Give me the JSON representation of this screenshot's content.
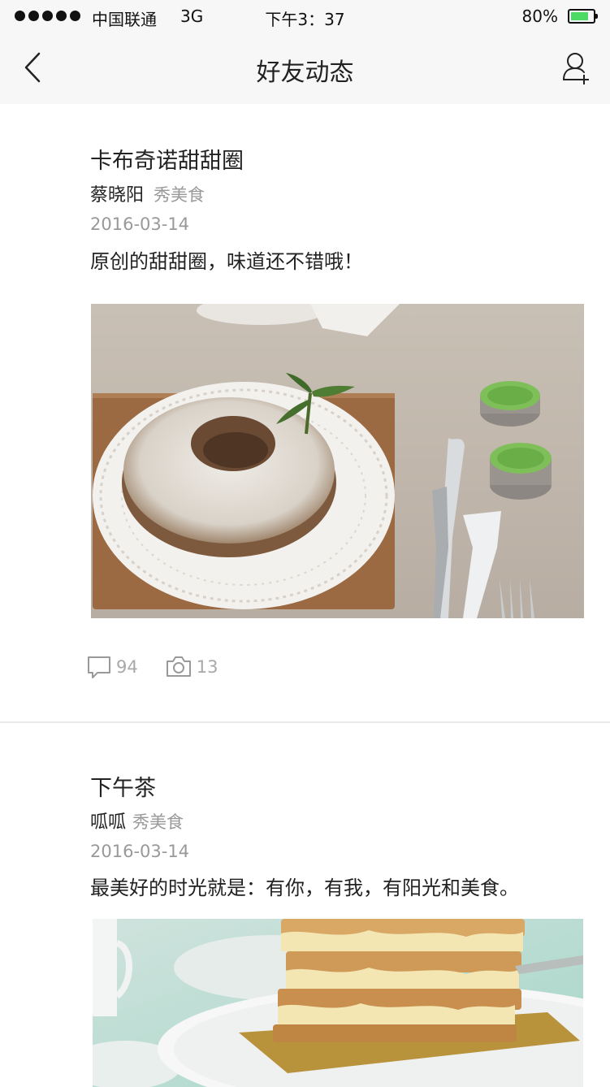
{
  "status_bar": {
    "carrier": "中国联通",
    "network": "3G",
    "time": "下午3：37",
    "battery": "80%",
    "battery_level": 0.8
  },
  "nav": {
    "title": "好友动态",
    "back_icon": "chevron-left-icon",
    "add_friend_icon": "add-user-icon"
  },
  "posts": [
    {
      "title": "卡布奇诺甜甜圈",
      "author": "蔡晓阳",
      "category": "秀美食",
      "date": "2016-03-14",
      "text": "原创的甜甜圈，味道还不错哦！",
      "comments": "94",
      "photos": "13"
    },
    {
      "title": "下午茶",
      "author": "呱呱",
      "category": "秀美食",
      "date": "2016-03-14",
      "text": "最美好的时光就是：有你，有我，有阳光和美食。"
    }
  ],
  "colors": {
    "bar_background": "#f7f7f7",
    "battery_fill": "#4cd964",
    "muted_text": "#999999"
  }
}
